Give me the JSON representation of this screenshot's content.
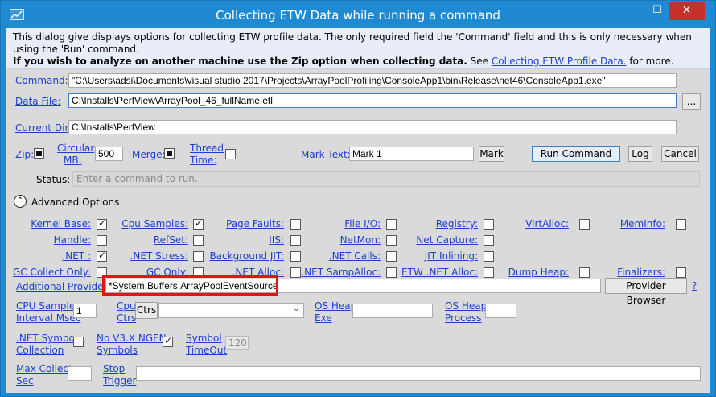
{
  "window": {
    "title": "Collecting ETW Data while running a command",
    "min_glyph": "–",
    "max_glyph": "☐",
    "close_glyph": "✕"
  },
  "description": {
    "line1": "This dialog give displays options for collecting ETW profile data. The only required field the 'Command' field and this is only necessary when using the 'Run' command.",
    "bold": "If you wish to analyze on another machine use the Zip option when collecting data.",
    "see": " See ",
    "link": "Collecting ETW Profile Data.",
    "more": " for more."
  },
  "command": {
    "label": "Command:",
    "value": "\"C:\\Users\\adsi\\Documents\\visual studio 2017\\Projects\\ArrayPoolProfiling\\ConsoleApp1\\bin\\Release\\net46\\ConsoleApp1.exe\""
  },
  "data_file": {
    "label": "Data File:",
    "value": "C:\\Installs\\PerfView\\ArrayPool_46_fullName.etl",
    "browse_label": "..."
  },
  "current_dir": {
    "label": "Current Dir:",
    "value": "C:\\Installs\\PerfView"
  },
  "options_row": {
    "zip_label": "Zip:",
    "circular_label_1": "Circular",
    "circular_label_2": "MB:",
    "circular_value": "500",
    "merge_label": "Merge:",
    "thread_label_1": "Thread",
    "thread_label_2": "Time:",
    "mark_text_label": "Mark Text:",
    "mark_text_value": "Mark 1",
    "mark_button": "Mark",
    "run_button": "Run Command",
    "log_button": "Log",
    "cancel_button": "Cancel"
  },
  "status": {
    "label": "Status:",
    "value": "Enter a command to run."
  },
  "advanced": {
    "toggle_glyph": "⌃",
    "label": "Advanced Options"
  },
  "providers": [
    {
      "label": "Kernel Base:",
      "checked": true
    },
    {
      "label": "Cpu Samples:",
      "checked": true
    },
    {
      "label": "Page Faults:",
      "checked": false
    },
    {
      "label": "File I/O:",
      "checked": false
    },
    {
      "label": "Registry:",
      "checked": false
    },
    {
      "label": "VirtAlloc:",
      "checked": false
    },
    {
      "label": "MemInfo:",
      "checked": false
    },
    {
      "label": "Handle:",
      "checked": false
    },
    {
      "label": "RefSet:",
      "checked": false
    },
    {
      "label": "IIS:",
      "checked": false
    },
    {
      "label": "NetMon:",
      "checked": false
    },
    {
      "label": "Net Capture:",
      "checked": false
    },
    {
      "label": ".NET :",
      "checked": true
    },
    {
      "label": ".NET Stress:",
      "checked": false
    },
    {
      "label": "Background JIT:",
      "checked": false
    },
    {
      "label": ".NET Calls:",
      "checked": false
    },
    {
      "label": "JIT Inlining:",
      "checked": false
    },
    {
      "label": "GC Collect Only:",
      "checked": false
    },
    {
      "label": "GC Only:",
      "checked": false
    },
    {
      "label": ".NET Alloc:",
      "checked": false
    },
    {
      "label": ".NET SampAlloc:",
      "checked": false
    },
    {
      "label": "ETW .NET Alloc:",
      "checked": false
    },
    {
      "label": "Dump Heap:",
      "checked": false
    },
    {
      "label": "Finalizers:",
      "checked": false
    }
  ],
  "additional_providers": {
    "label": "Additional Providers",
    "value": "*System.Buffers.ArrayPoolEventSource",
    "browser_button": "Provider Browser",
    "help": "?"
  },
  "cpu_sample": {
    "label_1": "CPU Sample",
    "label_2": "Interval Msec",
    "value": "1"
  },
  "cpu_ctrs": {
    "label_1": "Cpu",
    "label_2": "Ctrs",
    "button": "Ctrs",
    "dropdown_arrow": "⌄"
  },
  "os_heap_exe": {
    "label_1": "OS Heap",
    "label_2": "Exe",
    "value": ""
  },
  "os_heap_process": {
    "label_1": "OS Heap",
    "label_2": "Process",
    "value": ""
  },
  "net_symbol": {
    "label_1": ".NET Symbol",
    "label_2": "Collection"
  },
  "no_v3x": {
    "label_1": "No V3.X NGEN",
    "label_2": "Symbols",
    "checked": true
  },
  "symbol_timeout": {
    "label_1": "Symbol",
    "label_2": "TimeOut",
    "value": "120"
  },
  "max_collect": {
    "label_1": "Max Collect",
    "label_2": "Sec",
    "value": ""
  },
  "stop_trigger": {
    "label_1": "Stop",
    "label_2": "Trigger",
    "value": ""
  },
  "colors": {
    "titlebar": "#1f8ad2",
    "close": "#c7302a",
    "link": "#1b3fcf",
    "highlight": "#e01616"
  }
}
